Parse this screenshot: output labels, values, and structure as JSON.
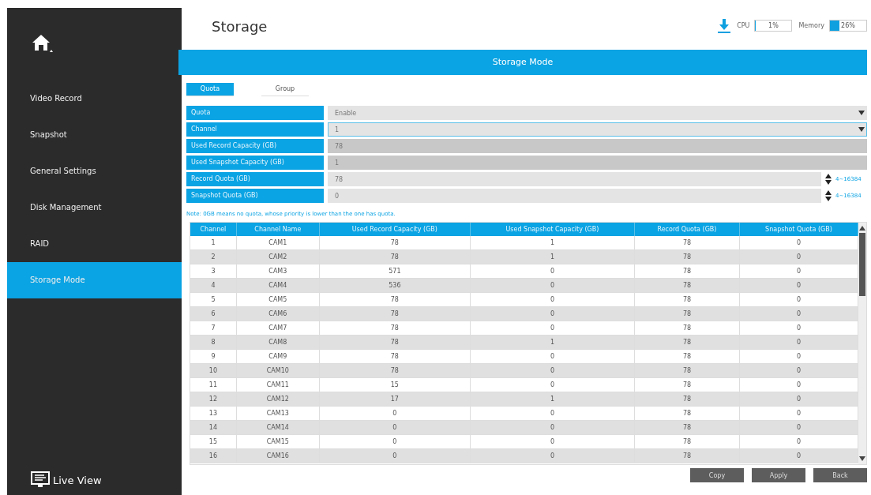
{
  "sidebar": {
    "items": [
      {
        "label": "Video Record",
        "selected": false
      },
      {
        "label": "Snapshot",
        "selected": false
      },
      {
        "label": "General Settings",
        "selected": false
      },
      {
        "label": "Disk Management",
        "selected": false
      },
      {
        "label": "RAID",
        "selected": false
      },
      {
        "label": "Storage Mode",
        "selected": true
      }
    ],
    "footer": "Live View"
  },
  "header": {
    "title": "Storage",
    "meters": [
      {
        "label": "CPU",
        "reading": "1%",
        "level": 0.01
      },
      {
        "label": "Memory",
        "reading": "26%",
        "level": 0.26
      }
    ]
  },
  "section_title": "Storage Mode",
  "tabs": [
    {
      "label": "Quota",
      "selected": true
    },
    {
      "label": "Group",
      "selected": false
    }
  ],
  "form": [
    {
      "label": "Quota",
      "value": "Enable",
      "kind": "select",
      "focused": false
    },
    {
      "label": "Channel",
      "value": "1",
      "kind": "select",
      "focused": true
    },
    {
      "label": "Used Record Capacity (GB)",
      "value": "78",
      "kind": "readonly"
    },
    {
      "label": "Used Snapshot Capacity (GB)",
      "value": "1",
      "kind": "readonly"
    },
    {
      "label": "Record Quota (GB)",
      "value": "78",
      "kind": "spinner",
      "range": "4~16384"
    },
    {
      "label": "Snapshot Quota (GB)",
      "value": "0",
      "kind": "spinner",
      "range": "4~16384"
    }
  ],
  "note": "Note: 0GB means no quota, whose priority is lower than the one has quota.",
  "table": {
    "columns": [
      "Channel",
      "Channel Name",
      "Used Record Capacity (GB)",
      "Used Snapshot Capacity (GB)",
      "Record Quota (GB)",
      "Snapshot Quota (GB)"
    ],
    "rows": [
      [
        "1",
        "CAM1",
        "78",
        "1",
        "78",
        "0"
      ],
      [
        "2",
        "CAM2",
        "78",
        "1",
        "78",
        "0"
      ],
      [
        "3",
        "CAM3",
        "571",
        "0",
        "78",
        "0"
      ],
      [
        "4",
        "CAM4",
        "536",
        "0",
        "78",
        "0"
      ],
      [
        "5",
        "CAM5",
        "78",
        "0",
        "78",
        "0"
      ],
      [
        "6",
        "CAM6",
        "78",
        "0",
        "78",
        "0"
      ],
      [
        "7",
        "CAM7",
        "78",
        "0",
        "78",
        "0"
      ],
      [
        "8",
        "CAM8",
        "78",
        "1",
        "78",
        "0"
      ],
      [
        "9",
        "CAM9",
        "78",
        "0",
        "78",
        "0"
      ],
      [
        "10",
        "CAM10",
        "78",
        "0",
        "78",
        "0"
      ],
      [
        "11",
        "CAM11",
        "15",
        "0",
        "78",
        "0"
      ],
      [
        "12",
        "CAM12",
        "17",
        "1",
        "78",
        "0"
      ],
      [
        "13",
        "CAM13",
        "0",
        "0",
        "78",
        "0"
      ],
      [
        "14",
        "CAM14",
        "0",
        "0",
        "78",
        "0"
      ],
      [
        "15",
        "CAM15",
        "0",
        "0",
        "78",
        "0"
      ],
      [
        "16",
        "CAM16",
        "0",
        "0",
        "78",
        "0"
      ]
    ]
  },
  "buttons": [
    "Copy",
    "Apply",
    "Back"
  ]
}
